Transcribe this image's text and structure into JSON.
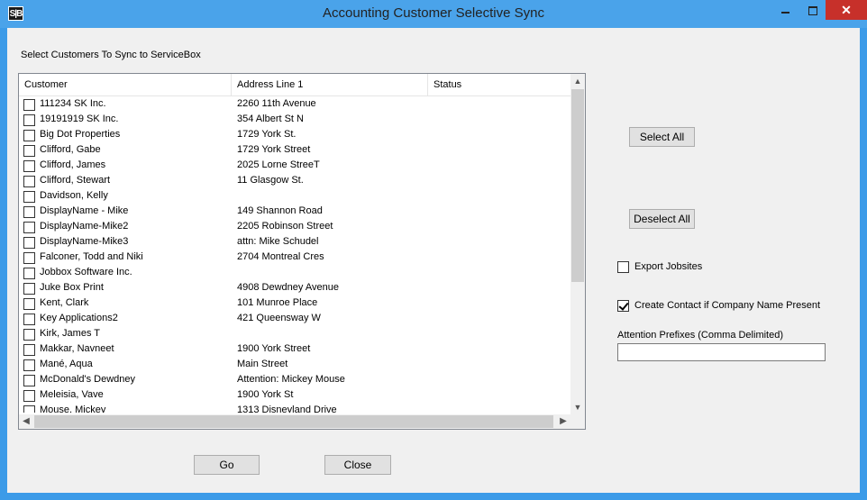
{
  "window": {
    "app_icon_text": "S|B",
    "title": "Accounting Customer Selective Sync"
  },
  "form": {
    "select_label": "Select Customers To Sync to ServiceBox",
    "columns": [
      "Customer",
      "Address Line 1",
      "Status"
    ],
    "rows": [
      {
        "name": "111234 SK Inc.",
        "address": "2260 11th Avenue",
        "checked": false
      },
      {
        "name": "19191919 SK Inc.",
        "address": "354 Albert St N",
        "checked": false
      },
      {
        "name": "Big Dot Properties",
        "address": "1729 York St.",
        "checked": false
      },
      {
        "name": "Clifford, Gabe",
        "address": "1729 York Street",
        "checked": false
      },
      {
        "name": "Clifford, James",
        "address": "2025 Lorne StreeT",
        "checked": false
      },
      {
        "name": "Clifford, Stewart",
        "address": "11 Glasgow St.",
        "checked": false
      },
      {
        "name": "Davidson, Kelly",
        "address": "",
        "checked": false
      },
      {
        "name": "DisplayName - Mike",
        "address": "149 Shannon Road",
        "checked": false
      },
      {
        "name": "DisplayName-Mike2",
        "address": "2205 Robinson Street",
        "checked": false
      },
      {
        "name": "DisplayName-Mike3",
        "address": "attn: Mike Schudel",
        "checked": false
      },
      {
        "name": "Falconer, Todd and Niki",
        "address": "2704 Montreal Cres",
        "checked": false
      },
      {
        "name": "Jobbox Software Inc.",
        "address": "",
        "checked": false
      },
      {
        "name": "Juke Box Print",
        "address": "4908 Dewdney Avenue",
        "checked": false
      },
      {
        "name": "Kent, Clark",
        "address": "101 Munroe Place",
        "checked": false
      },
      {
        "name": "Key Applications2",
        "address": "421 Queensway W",
        "checked": false
      },
      {
        "name": "Kirk, James T",
        "address": "",
        "checked": false
      },
      {
        "name": "Makkar, Navneet",
        "address": "1900 York Street",
        "checked": false
      },
      {
        "name": "Mané, Aqua",
        "address": "Main Street",
        "checked": false
      },
      {
        "name": "McDonald's Dewdney",
        "address": "Attention: Mickey Mouse",
        "checked": false
      },
      {
        "name": "Meleisia, Vave",
        "address": "1900 York St",
        "checked": false
      },
      {
        "name": "Mouse, Mickey",
        "address": "1313 Disneyland Drive",
        "checked": false
      }
    ],
    "select_all_label": "Select All",
    "deselect_all_label": "Deselect All",
    "export_jobsites_label": "Export Jobsites",
    "export_jobsites_checked": false,
    "create_contact_label": "Create Contact if Company Name Present",
    "create_contact_checked": true,
    "attention_prefixes_label": "Attention Prefixes (Comma Delimited)",
    "attention_prefixes_value": "",
    "go_label": "Go",
    "close_label": "Close"
  },
  "icons": {
    "scroll_up": "▲",
    "scroll_down": "▼",
    "scroll_left": "◀",
    "scroll_right": "▶"
  }
}
